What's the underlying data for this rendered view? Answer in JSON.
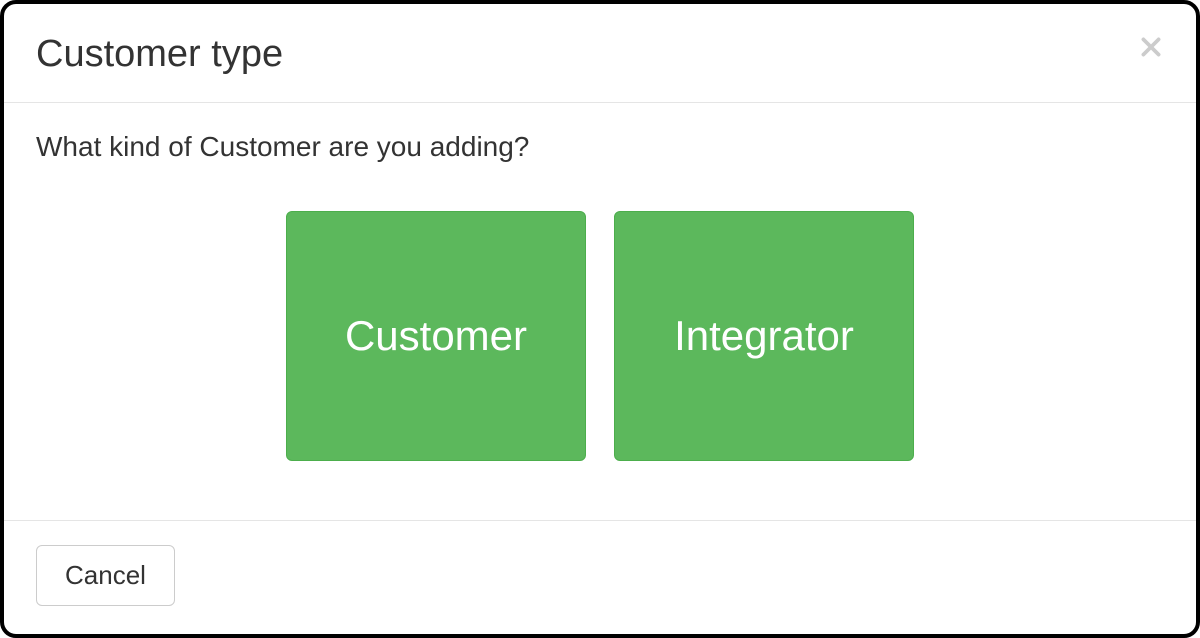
{
  "modal": {
    "title": "Customer type",
    "prompt": "What kind of Customer are you adding?",
    "choices": {
      "customer": "Customer",
      "integrator": "Integrator"
    },
    "cancel_label": "Cancel"
  }
}
